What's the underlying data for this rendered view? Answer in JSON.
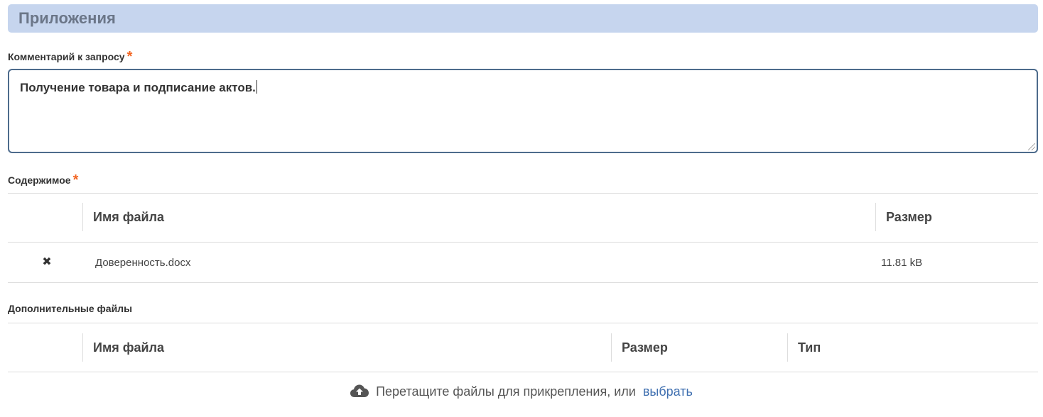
{
  "section": {
    "title": "Приложения"
  },
  "comment": {
    "label": "Комментарий к запросу",
    "required_mark": "*",
    "value": "Получение товара и подписание актов."
  },
  "contents": {
    "label": "Содержимое",
    "required_mark": "*",
    "columns": [
      "Имя файла",
      "Размер"
    ],
    "rows": [
      {
        "remove_icon": "✖",
        "name": "Доверенность.docx",
        "size": "11.81 kB"
      }
    ]
  },
  "additional": {
    "label": "Дополнительные файлы",
    "columns": [
      "Имя файла",
      "Размер",
      "Тип"
    ]
  },
  "dropzone": {
    "icon": "cloud-upload-icon",
    "text": "Перетащите файлы для прикрепления, или",
    "link": "выбрать"
  },
  "colors": {
    "header_bg": "#c6d5ee",
    "required": "#f26522",
    "link": "#3f6fb0",
    "input_border": "#4d6b8c"
  }
}
